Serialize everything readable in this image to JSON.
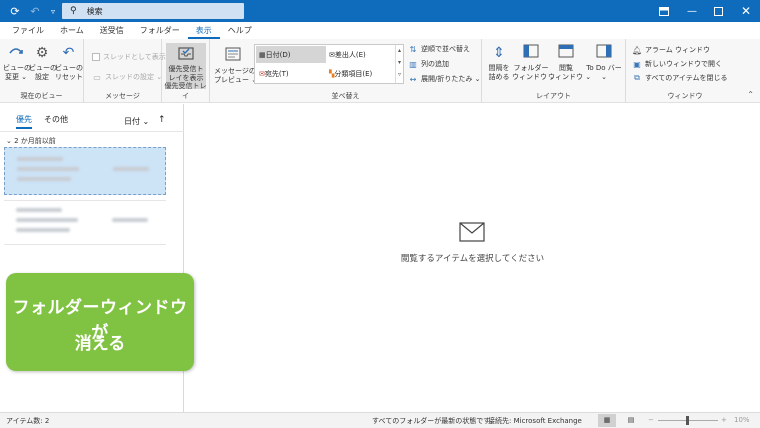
{
  "titlebar": {
    "search_placeholder": "検索"
  },
  "menu": {
    "tabs": [
      "ファイル",
      "ホーム",
      "送受信",
      "フォルダー",
      "表示",
      "ヘルプ"
    ],
    "active_index": 4
  },
  "ribbon": {
    "current_view": {
      "label": "現在のビュー",
      "change_view": "ビューの\n変更 ⌄",
      "view_settings": "ビューの\n設定",
      "reset_view": "ビューの\nリセット"
    },
    "messages": {
      "label": "メッセージ",
      "show_as_conversations": "スレッドとして表示",
      "conversation_settings": "スレッドの設定 ⌄"
    },
    "focused_inbox": {
      "label": "優先受信トレイ",
      "button": "優先受信ト\nレイを表示"
    },
    "arrangement": {
      "label": "並べ替え",
      "message_preview": "メッセージの\nプレビュー ⌄",
      "items": [
        "日付(D)",
        "宛先(T)",
        "差出人(E)",
        "分類項目(E)"
      ],
      "reverse_sort": "逆順で並べ替え",
      "add_columns": "列の追加",
      "expand_collapse": "展開/折りたたみ ⌄"
    },
    "layout": {
      "label": "レイアウト",
      "spacing": "間隔を\n詰める",
      "folder_pane": "フォルダー\nウィンドウ ⌄",
      "reading_pane": "閲覧\nウィンドウ ⌄",
      "todo_bar": "To Do バー\n⌄"
    },
    "window": {
      "label": "ウィンドウ",
      "reminders": "アラーム ウィンドウ",
      "open_new_window": "新しいウィンドウで開く",
      "close_all": "すべてのアイテムを閉じる"
    }
  },
  "leftpane": {
    "tab_focused": "優先",
    "tab_other": "その他",
    "sort_label": "日付 ⌄",
    "sort_dir": "↑",
    "group_header": "2 か月前以前"
  },
  "reading": {
    "empty_text": "閲覧するアイテムを選択してください"
  },
  "callout": {
    "line1": "フォルダーウィンドウが",
    "line2": "消える"
  },
  "statusbar": {
    "item_count": "アイテム数: 2",
    "sync_status": "すべてのフォルダーが最新の状態です。",
    "connection": "接続先: Microsoft Exchange",
    "zoom": "10%"
  }
}
